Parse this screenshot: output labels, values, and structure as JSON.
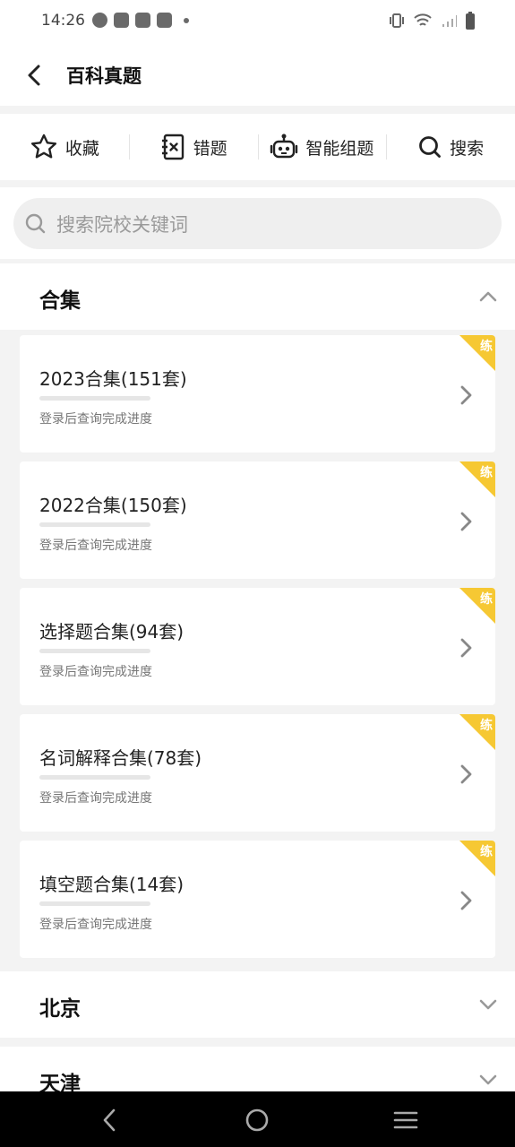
{
  "status_bar": {
    "time": "14:26"
  },
  "header": {
    "title": "百科真题"
  },
  "toolbar": [
    {
      "label": "收藏",
      "icon": "star-icon"
    },
    {
      "label": "错题",
      "icon": "wrong-notebook-icon"
    },
    {
      "label": "智能组题",
      "icon": "robot-icon"
    },
    {
      "label": "搜索",
      "icon": "search-icon"
    }
  ],
  "search": {
    "placeholder": "搜索院校关键词"
  },
  "sections": {
    "collection": {
      "title": "合集",
      "expanded": true
    },
    "beijing": {
      "title": "北京",
      "expanded": false
    },
    "tianjin": {
      "title": "天津",
      "expanded": false
    }
  },
  "cards": [
    {
      "title": "2023合集(151套)",
      "subtitle": "登录后查询完成进度",
      "badge": "练",
      "progress": 0
    },
    {
      "title": "2022合集(150套)",
      "subtitle": "登录后查询完成进度",
      "badge": "练",
      "progress": 0
    },
    {
      "title": "选择题合集(94套)",
      "subtitle": "登录后查询完成进度",
      "badge": "练",
      "progress": 0
    },
    {
      "title": "名词解释合集(78套)",
      "subtitle": "登录后查询完成进度",
      "badge": "练",
      "progress": 0
    },
    {
      "title": "填空题合集(14套)",
      "subtitle": "登录后查询完成进度",
      "badge": "练",
      "progress": 0
    }
  ],
  "colors": {
    "accent": "#f6c833",
    "background": "#f3f3f3",
    "navbar": "#000000"
  }
}
